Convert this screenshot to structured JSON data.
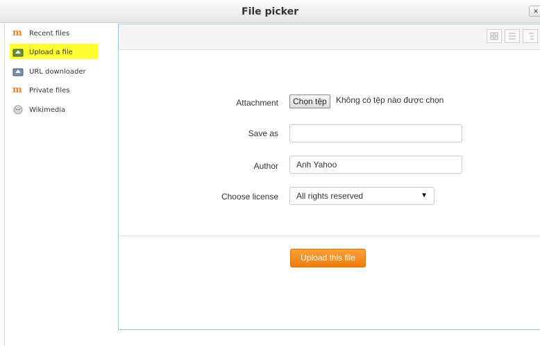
{
  "window": {
    "title": "File picker",
    "close_label": "×"
  },
  "sidebar": {
    "items": [
      {
        "label": "Recent files",
        "icon": "moodle-icon",
        "active": false
      },
      {
        "label": "Upload a file",
        "icon": "upload-icon",
        "active": true
      },
      {
        "label": "URL downloader",
        "icon": "url-downloader-icon",
        "active": false
      },
      {
        "label": "Private files",
        "icon": "moodle-icon",
        "active": false
      },
      {
        "label": "Wikimedia",
        "icon": "wikimedia-icon",
        "active": false
      }
    ]
  },
  "toolbar": {
    "views": [
      "icon-view",
      "list-view",
      "tree-view"
    ]
  },
  "form": {
    "attachment_label": "Attachment",
    "choose_button": "Chọn tệp",
    "no_file_text": "Không có tệp nào được chọn",
    "saveas_label": "Save as",
    "saveas_value": "",
    "author_label": "Author",
    "author_value": "Anh Yahoo",
    "license_label": "Choose license",
    "license_value": "All rights reserved",
    "upload_button": "Upload this file"
  },
  "colors": {
    "highlight": "#ffff33",
    "accent_orange": "#f47c20",
    "panel_border": "#9fc6e7"
  }
}
